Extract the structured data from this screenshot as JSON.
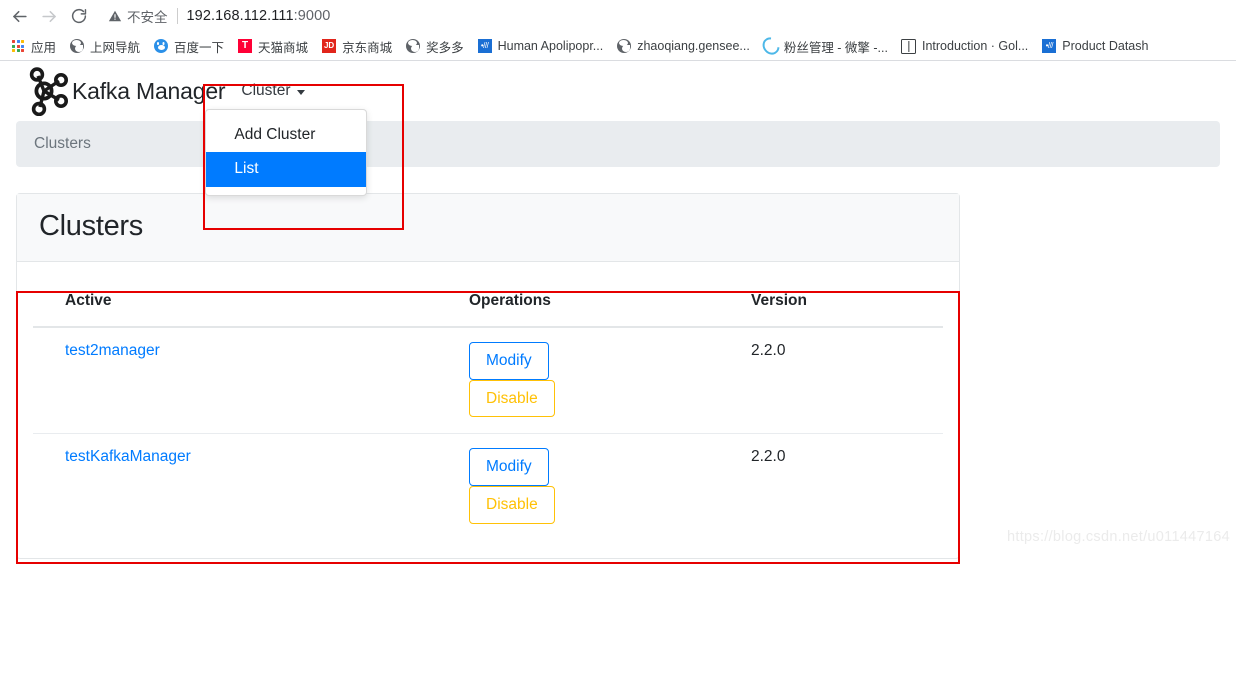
{
  "browser": {
    "nav": {
      "back_title": "Back",
      "forward_title": "Forward",
      "reload_title": "Reload"
    },
    "omnibox": {
      "security_label": "不安全",
      "url_host": "192.168.112.111",
      "url_port": ":9000"
    },
    "bookmarks": [
      {
        "label": "应用",
        "icon": "apps-grid-icon"
      },
      {
        "label": "上网导航",
        "icon": "globe-icon"
      },
      {
        "label": "百度一下",
        "icon": "baidu-paw-icon"
      },
      {
        "label": "天猫商城",
        "icon": "tmall-icon",
        "glyph": "T"
      },
      {
        "label": "京东商城",
        "icon": "jd-icon",
        "glyph": "JD"
      },
      {
        "label": "奖多多",
        "icon": "globe-icon"
      },
      {
        "label": "Human Apolipopr...",
        "icon": "blue-square-icon",
        "glyph": "•///"
      },
      {
        "label": "zhaoqiang.gensee...",
        "icon": "globe-icon"
      },
      {
        "label": "粉丝管理 - 微擎 -...",
        "icon": "spiral-icon"
      },
      {
        "label": "Introduction · Gol...",
        "icon": "book-icon"
      },
      {
        "label": "Product Datash",
        "icon": "blue-square-icon",
        "glyph": "•///"
      }
    ]
  },
  "app": {
    "brand": "Kafka Manager",
    "brand_logo_icon": "kafka-logo-icon",
    "navbar": {
      "cluster_menu_label": "Cluster",
      "caret_icon": "caret-down-icon",
      "menu_items": [
        {
          "label": "Add Cluster",
          "active": false
        },
        {
          "label": "List",
          "active": true
        }
      ]
    },
    "breadcrumb": {
      "current": "Clusters"
    },
    "card": {
      "title": "Clusters",
      "table": {
        "columns": [
          "Active",
          "Operations",
          "Version"
        ],
        "rows": [
          {
            "name": "test2manager",
            "modify_label": "Modify",
            "disable_label": "Disable",
            "version": "2.2.0"
          },
          {
            "name": "testKafkaManager",
            "modify_label": "Modify",
            "disable_label": "Disable",
            "version": "2.2.0"
          }
        ]
      }
    }
  },
  "watermark": "https://blog.csdn.net/u011447164",
  "colors": {
    "primary": "#007bff",
    "warning": "#ffc107",
    "annotation": "#e60000",
    "breadcrumb_bg": "#e9ecef",
    "card_header_bg": "#f8f9fa",
    "muted_text": "#6c757d"
  }
}
